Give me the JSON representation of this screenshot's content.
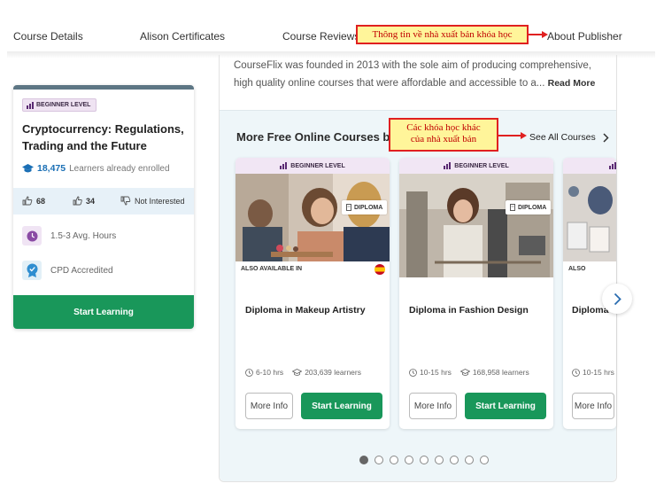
{
  "nav": {
    "items": [
      "Course Details",
      "Alison Certificates",
      "Course Reviews",
      "About Publisher"
    ]
  },
  "annotations": {
    "publisher_info": "Thông  tin  về  nhà  xuất  bản khóa  học",
    "other_courses_line1": "Các khóa học khác",
    "other_courses_line2": "của nhà xuất bản"
  },
  "course": {
    "level": "BEGINNER LEVEL",
    "title": "Cryptocurrency: Regulations, Trading and the Future",
    "enrolled_count": "18,475",
    "enrolled_label": "Learners already enrolled",
    "likes": "68",
    "thumbs": "34",
    "not_interested": "Not Interested",
    "hours": "1.5-3 Avg. Hours",
    "accreditation": "CPD Accredited",
    "start_label": "Start Learning"
  },
  "about": {
    "text": "CourseFlix was founded in 2013 with the sole aim of producing comprehensive, high quality online courses that were affordable and accessible to a...",
    "read_more": "Read More"
  },
  "more_courses": {
    "title": "More Free Online Courses by T",
    "see_all": "See All Courses",
    "cards": [
      {
        "level": "BEGINNER LEVEL",
        "type": "DIPLOMA",
        "also_available": "ALSO AVAILABLE IN",
        "title": "Diploma in Makeup Artistry",
        "hours": "6-10 hrs",
        "learners": "203,639 learners",
        "more_info": "More Info",
        "start": "Start Learning"
      },
      {
        "level": "BEGINNER LEVEL",
        "type": "DIPLOMA",
        "also_available": "",
        "title": "Diploma in Fashion Design",
        "hours": "10-15 hrs",
        "learners": "168,958 learners",
        "more_info": "More Info",
        "start": "Start Learning"
      },
      {
        "level": "",
        "type": "",
        "also_available": "ALSO AVAILABLE",
        "title": "Diploma i",
        "hours": "10-15 hrs",
        "learners": "",
        "more_info": "More Info",
        "start": ""
      }
    ],
    "pagination_total": 9,
    "pagination_active": 1
  },
  "colors": {
    "accent_green": "#19975a",
    "enrolled_blue": "#1a6fb5",
    "annotation_fill": "#fff59a",
    "annotation_border": "#e02020"
  }
}
